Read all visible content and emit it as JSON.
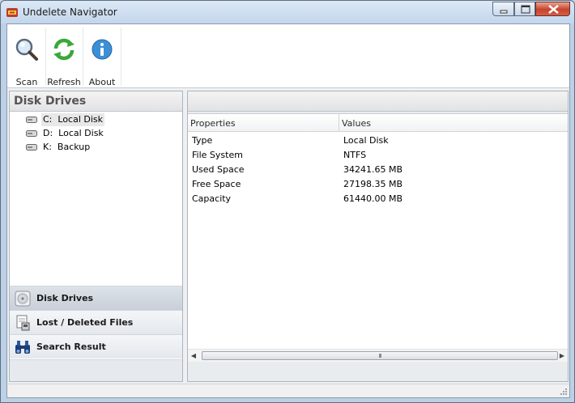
{
  "window": {
    "title": "Undelete Navigator"
  },
  "toolbar": {
    "buttons": [
      {
        "label": "Scan",
        "icon": "magnifier-icon"
      },
      {
        "label": "Refresh",
        "icon": "refresh-icon"
      },
      {
        "label": "About",
        "icon": "info-icon"
      }
    ]
  },
  "left_pane": {
    "header": "Disk Drives",
    "drives": [
      {
        "text": "C:  Local Disk",
        "selected": true
      },
      {
        "text": "D:  Local Disk",
        "selected": false
      },
      {
        "text": "K:  Backup",
        "selected": false
      }
    ],
    "nav": [
      {
        "label": "Disk Drives",
        "icon": "disk-drive-icon",
        "active": true
      },
      {
        "label": "Lost / Deleted Files",
        "icon": "deleted-files-icon",
        "active": false
      },
      {
        "label": "Search Result",
        "icon": "binoculars-icon",
        "active": false
      }
    ]
  },
  "properties": {
    "columns": [
      "Properties",
      "Values"
    ],
    "rows": [
      {
        "property": "Type",
        "value": "Local Disk"
      },
      {
        "property": "File System",
        "value": "NTFS"
      },
      {
        "property": "Used Space",
        "value": "34241.65 MB"
      },
      {
        "property": "Free Space",
        "value": "27198.35 MB"
      },
      {
        "property": "Capacity",
        "value": "61440.00 MB"
      }
    ],
    "scroll_grip": "III"
  },
  "colors": {
    "title_bar": "#c3d6ec",
    "close_button": "#c7432b",
    "active_nav": "#c9d0d9"
  }
}
